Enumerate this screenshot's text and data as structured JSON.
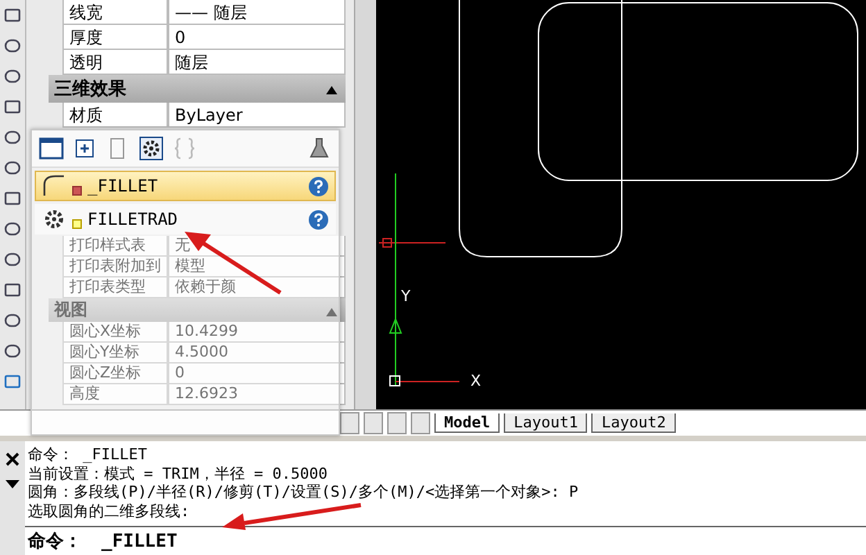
{
  "properties": [
    {
      "kind": "row",
      "name": "线宽",
      "value": "—— 随层"
    },
    {
      "kind": "row",
      "name": "厚度",
      "value": "0"
    },
    {
      "kind": "row",
      "name": "透明",
      "value": "随层"
    },
    {
      "kind": "section",
      "name": "三维效果",
      "expanded": true
    },
    {
      "kind": "row",
      "name": "材质",
      "value": "ByLayer"
    },
    {
      "kind": "blank"
    },
    {
      "kind": "blank"
    },
    {
      "kind": "blank"
    },
    {
      "kind": "row",
      "name": "打印样式表",
      "value": "无"
    },
    {
      "kind": "row",
      "name": "打印表附加到",
      "value": "模型"
    },
    {
      "kind": "row",
      "name": "打印表类型",
      "value": "依赖于颜"
    },
    {
      "kind": "section",
      "name": "视图",
      "expanded": true
    },
    {
      "kind": "row",
      "name": "圆心X坐标",
      "value": "10.4299"
    },
    {
      "kind": "row",
      "name": "圆心Y坐标",
      "value": "4.5000"
    },
    {
      "kind": "row",
      "name": "圆心Z坐标",
      "value": "0"
    },
    {
      "kind": "row",
      "name": "高度",
      "value": "12.6923"
    }
  ],
  "popup": {
    "items": [
      {
        "kind": "fillet",
        "label": "_FILLET",
        "selected": true
      },
      {
        "kind": "gear",
        "label": "FILLETRAD",
        "selected": false
      }
    ]
  },
  "axes": {
    "y": "Y",
    "x": "X"
  },
  "tabs": [
    {
      "label": "Model",
      "selected": true
    },
    {
      "label": "Layout1",
      "selected": false
    },
    {
      "label": "Layout2",
      "selected": false
    }
  ],
  "command": {
    "history": [
      "命令： _FILLET",
      "当前设置：模式 = TRIM，半径 = 0.5000",
      "圆角：多段线(P)/半径(R)/修剪(T)/设置(S)/多个(M)/<选择第一个对象>: P",
      "选取圆角的二维多段线:"
    ],
    "prompt": "命令：",
    "value": "_FILLET"
  }
}
